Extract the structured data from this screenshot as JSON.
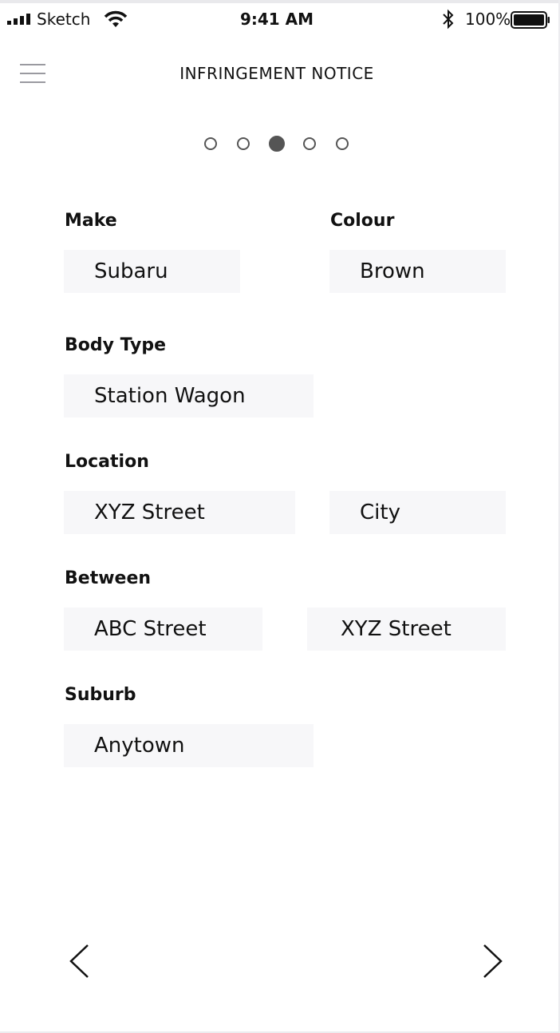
{
  "status_bar": {
    "carrier": "Sketch",
    "time": "9:41 AM",
    "battery_percent": "100%",
    "icons": [
      "signal-icon",
      "wifi-icon",
      "bluetooth-icon",
      "battery-icon"
    ]
  },
  "header": {
    "title": "INFRINGEMENT NOTICE",
    "menu_icon": "hamburger-menu-icon"
  },
  "pager": {
    "total": 5,
    "current": 3
  },
  "form": {
    "make": {
      "label": "Make",
      "value": "Subaru"
    },
    "colour": {
      "label": "Colour",
      "value": "Brown"
    },
    "body_type": {
      "label": "Body Type",
      "value": "Station Wagon"
    },
    "location": {
      "label": "Location",
      "street": "XYZ Street",
      "city": "City"
    },
    "between": {
      "label": "Between",
      "from": "ABC Street",
      "to": "XYZ Street"
    },
    "suburb": {
      "label": "Suburb",
      "value": "Anytown"
    }
  },
  "nav": {
    "prev_icon": "chevron-left-icon",
    "next_icon": "chevron-right-icon"
  },
  "colors": {
    "field_background": "#f7f7f9",
    "dot": "#555555",
    "menu_lines": "#9a9aa0"
  }
}
